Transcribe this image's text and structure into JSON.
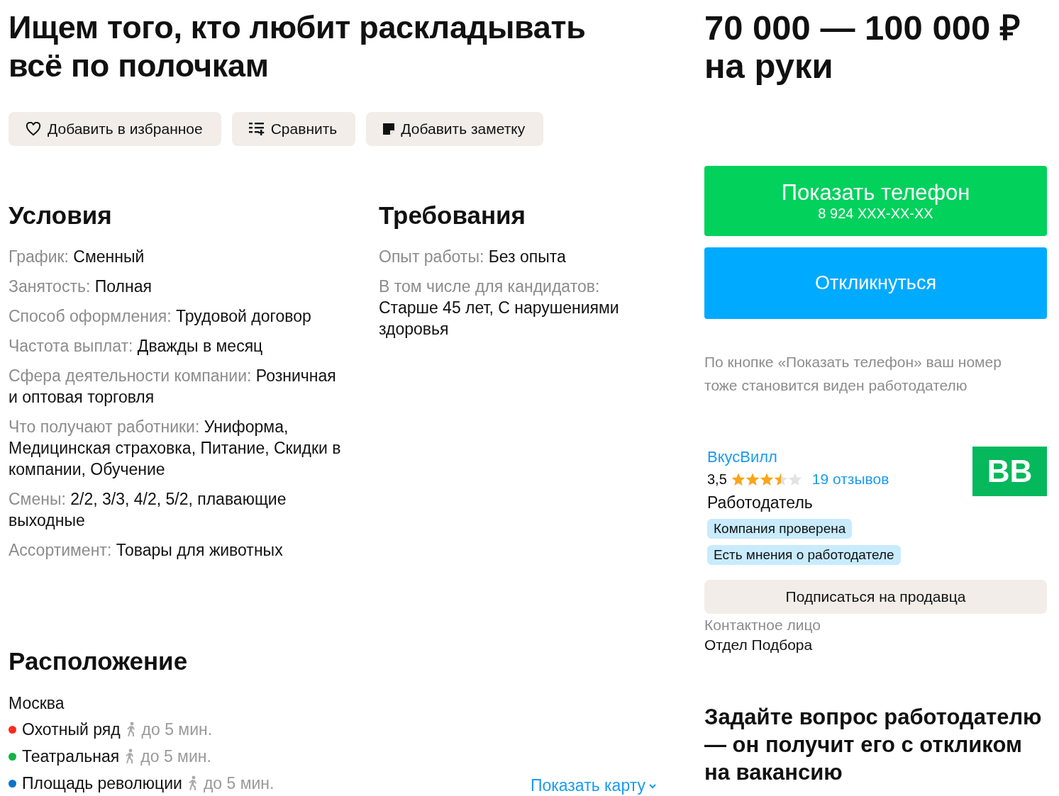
{
  "title": "Ищем того, кто любит раскладывать всё по полочкам",
  "actions": [
    {
      "kind": "heart",
      "label": "Добавить в избранное"
    },
    {
      "kind": "compare",
      "label": "Сравнить"
    },
    {
      "kind": "note",
      "label": "Добавить заметку"
    }
  ],
  "conditions": {
    "heading": "Условия",
    "items": [
      {
        "label": "График:",
        "value": "Сменный"
      },
      {
        "label": "Занятость:",
        "value": "Полная"
      },
      {
        "label": "Способ оформления:",
        "value": "Трудовой договор"
      },
      {
        "label": "Частота выплат:",
        "value": "Дважды в месяц"
      },
      {
        "label": "Сфера деятельности компании:",
        "value": "Розничная и оптовая торговля"
      },
      {
        "label": "Что получают работники:",
        "value": "Униформа, Медицинская страховка, Питание, Скидки в компании, Обучение"
      },
      {
        "label": "Смены:",
        "value": "2/2, 3/3, 4/2, 5/2, плавающие выходные"
      },
      {
        "label": "Ассортимент:",
        "value": "Товары для животных"
      }
    ]
  },
  "requirements": {
    "heading": "Требования",
    "items": [
      {
        "label": "Опыт работы:",
        "value": "Без опыта"
      },
      {
        "label": "В том числе для кандидатов:",
        "value": "Старше 45 лет, С нарушениями здоровья"
      }
    ]
  },
  "location": {
    "heading": "Расположение",
    "city": "Москва",
    "stations": [
      {
        "name": "Охотный ряд",
        "color": "#ff2b1c",
        "walk": "до 5 мин."
      },
      {
        "name": "Театральная",
        "color": "#11b443",
        "walk": "до 5 мин."
      },
      {
        "name": "Площадь революции",
        "color": "#0a74c9",
        "walk": "до 5 мин."
      }
    ],
    "map_link": "Показать карту"
  },
  "salary": "70 000 — 100 000 ₽ на руки",
  "phone_button": {
    "label": "Показать телефон",
    "phone": "8 924 XXX-XX-XX"
  },
  "respond_button": "Откликнуться",
  "phone_note": "По кнопке «Показать телефон» ваш номер тоже становится виден работодателю",
  "employer": {
    "name": "ВкусВилл",
    "rating": "3,5",
    "stars": 3.5,
    "reviews": "19 отзывов",
    "role": "Работодатель",
    "logo_text": "ВВ",
    "badges": [
      "Компания проверена",
      "Есть мнения о работодателе"
    ]
  },
  "subscribe_button": "Подписаться на продавца",
  "contact": {
    "label": "Контактное лицо",
    "value": "Отдел Подбора"
  },
  "question_heading": "Задайте вопрос работодателю — он получит его с откликом на вакансию"
}
